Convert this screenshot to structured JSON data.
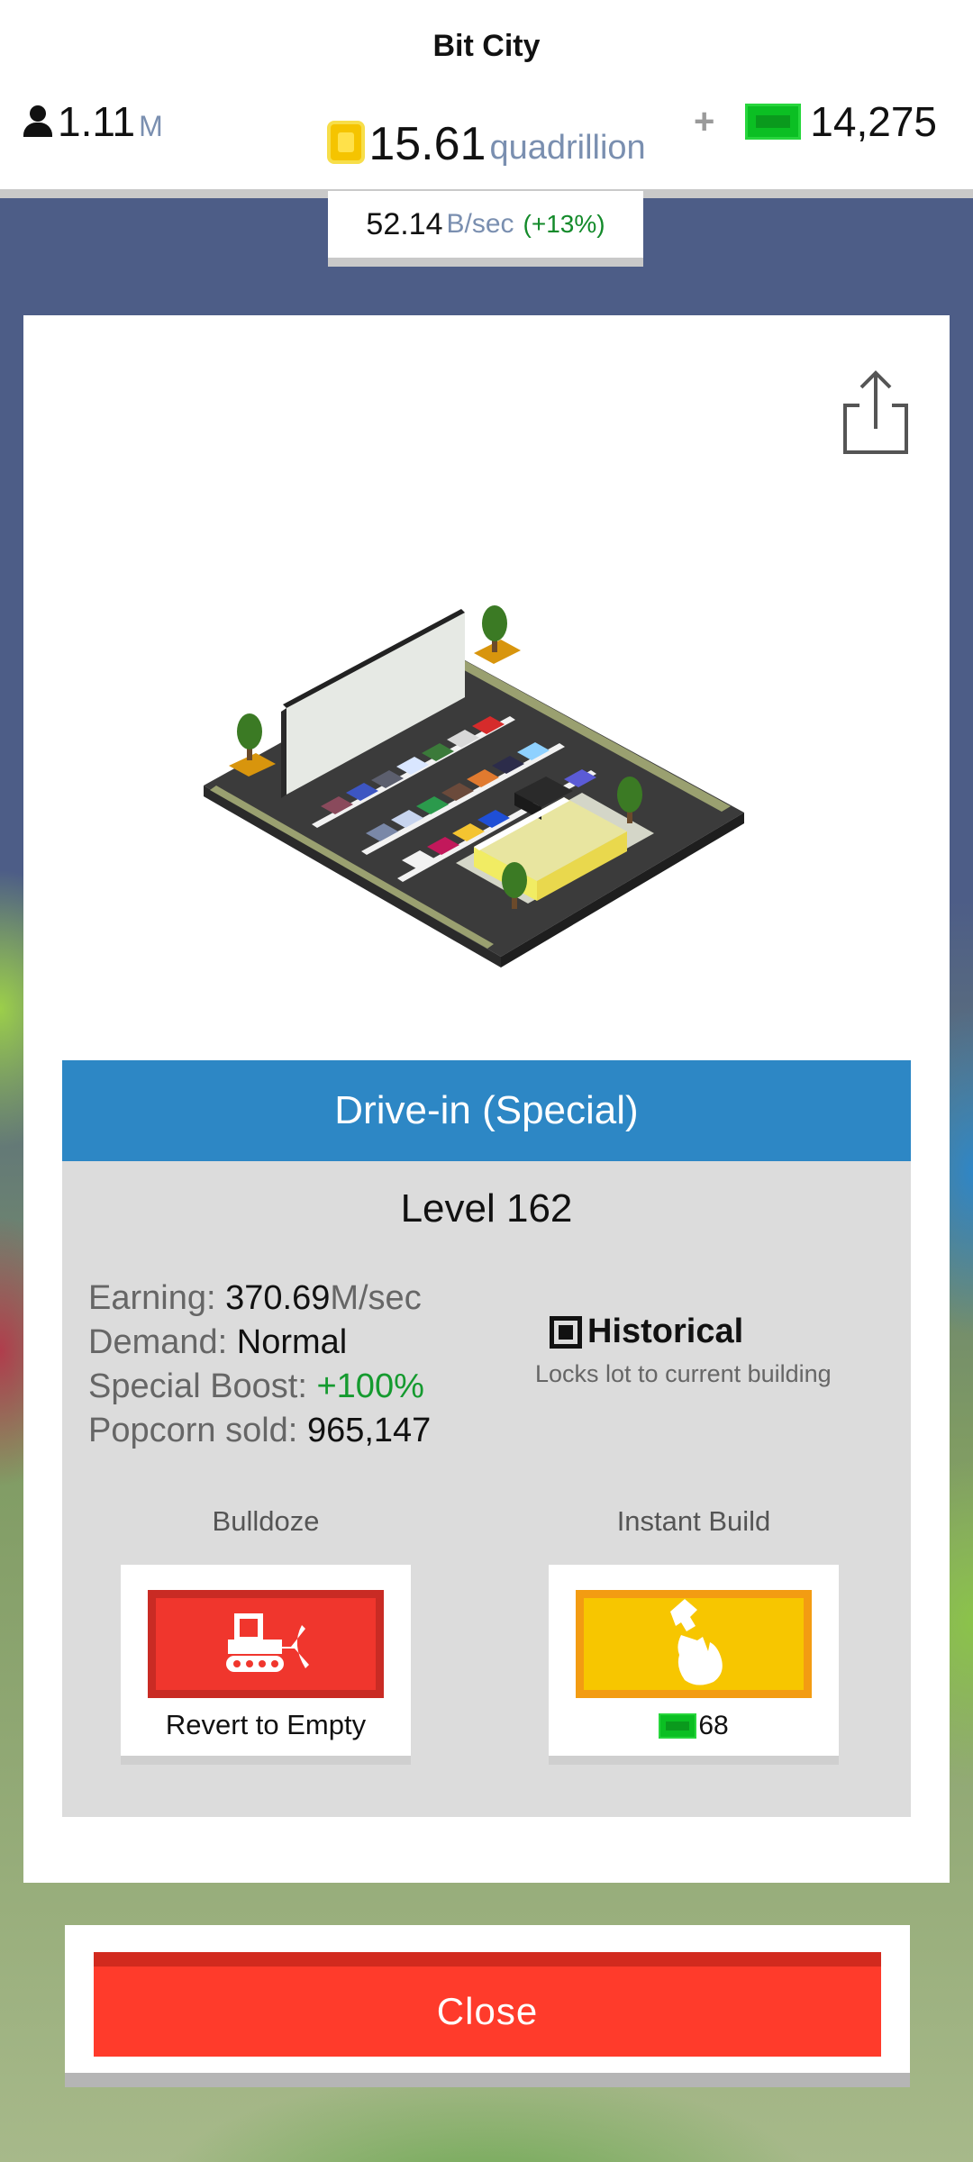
{
  "header": {
    "city_name": "Bit City",
    "population": {
      "value": "1.11",
      "unit": "M"
    },
    "coins": {
      "value": "15.61",
      "unit": "quadrillion"
    },
    "cash": {
      "plus": "+",
      "value": "14,275"
    },
    "rate": {
      "value": "52.14",
      "unit": "B/sec",
      "change": "(+13%)"
    }
  },
  "building": {
    "name": "Drive-in (Special)",
    "level": "Level 162",
    "stats": {
      "earning_label": "Earning:",
      "earning_value": "370.69",
      "earning_unit": "M/sec",
      "demand_label": "Demand:",
      "demand_value": "Normal",
      "boost_label": "Special Boost:",
      "boost_value": "+100%",
      "popcorn_label": "Popcorn sold:",
      "popcorn_value": "965,147"
    },
    "historical": {
      "title": "Historical",
      "subtitle": "Locks lot to current building"
    }
  },
  "actions": {
    "bulldoze": {
      "label": "Bulldoze",
      "caption": "Revert to Empty"
    },
    "instant_build": {
      "label": "Instant Build",
      "cost": "68"
    }
  },
  "footer": {
    "close_label": "Close"
  },
  "icons": {
    "population": "person-icon",
    "coins": "coin-icon",
    "cash": "bill-icon",
    "share": "share-icon",
    "bulldoze": "bulldozer-icon",
    "instant_build": "hammer-hand-icon",
    "historical": "checkbox-icon"
  },
  "colors": {
    "header_blue": "#2d87c5",
    "bulldoze_red": "#f0362d",
    "instant_yellow": "#f7c600",
    "close_red": "#ff3b2b",
    "boost_green": "#159a2f",
    "cash_green": "#0bbf23"
  }
}
